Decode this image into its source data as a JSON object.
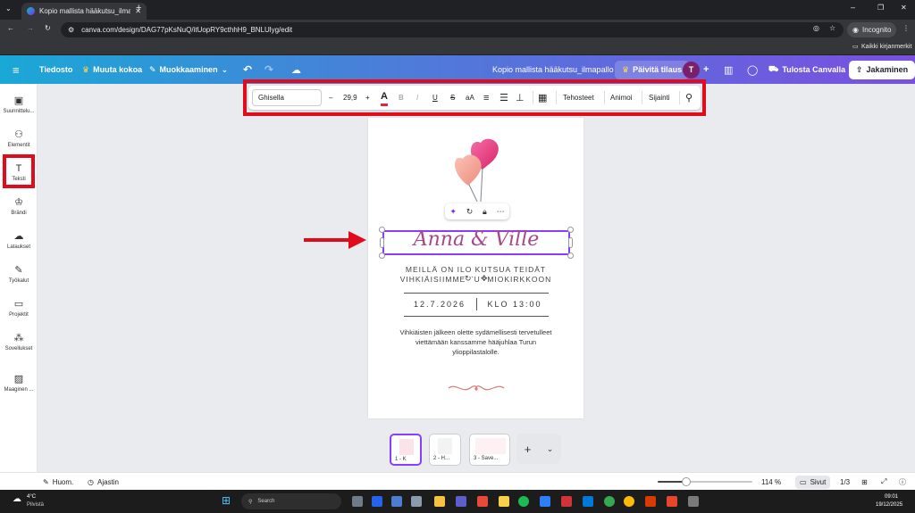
{
  "browser": {
    "tab_title": "Kopio mallista hääkutsu_ilmapallo",
    "url": "canva.com/design/DAG77pKsNuQ/itUopRY9cthhH9_BNLUlyg/edit",
    "incognito_label": "Incognito",
    "bookmarks_label": "Kaikki kirjanmerkit"
  },
  "topbar": {
    "file": "Tiedosto",
    "resize": "Muuta kokoa",
    "editing": "Muokkaaminen",
    "doc_title": "Kopio mallista hääkutsu_ilmapallo",
    "upgrade": "Päivitä tilaus",
    "avatar": "T",
    "print": "Tulosta Canvalla",
    "share": "Jakaminen"
  },
  "sidebar": {
    "items": [
      {
        "label": "Suunnittelu...",
        "icon": "layout-icon"
      },
      {
        "label": "Elementit",
        "icon": "shapes-icon"
      },
      {
        "label": "Teksti",
        "icon": "text-icon"
      },
      {
        "label": "Brändi",
        "icon": "brand-icon"
      },
      {
        "label": "Lataukset",
        "icon": "upload-cloud-icon"
      },
      {
        "label": "Työkalut",
        "icon": "pen-icon"
      },
      {
        "label": "Projektit",
        "icon": "folder-icon"
      },
      {
        "label": "Sovellukset",
        "icon": "apps-icon"
      },
      {
        "label": "Maaginen ...",
        "icon": "magic-icon"
      }
    ]
  },
  "text_toolbar": {
    "font": "Ghisella",
    "minus": "–",
    "size": "29,9",
    "plus": "+",
    "color_letter": "A",
    "bold": "B",
    "italic": "I",
    "underline": "U",
    "strike": "S",
    "case": "aA",
    "effects": "Tehosteet",
    "animate": "Animoi",
    "position": "Sijainti"
  },
  "page": {
    "names": "Anna & Ville",
    "line1": "MEILLÄ ON ILO KUTSUA TEIDÄT",
    "line2": "VIHKIÄISIIMME TUOMIOKIRKKOON",
    "date": "12.7.2026",
    "time": "KLO 13:00",
    "body": "Vihkiäisten jälkeen olette sydämellisesti tervetulleet viettämään kanssamme hääjuhlaa Turun ylioppilastalolle."
  },
  "pages_strip": {
    "thumbs": [
      "1 - K",
      "2 - H...",
      "3 - Save..."
    ],
    "add": "+"
  },
  "status": {
    "notes": "Huom.",
    "timer": "Ajastin",
    "zoom": "114 %",
    "pages_label": "Sivut",
    "page_count": "1/3",
    "zoom_value": 0.3
  },
  "taskbar": {
    "temp": "4°C",
    "weather": "Pilvistä",
    "search": "Search",
    "time": "09:01",
    "date": "19/12/2025"
  },
  "colors": {
    "annotation_red": "#e00c1b",
    "names_purple": "#a8478b",
    "selection_purple": "#8b3dff"
  }
}
